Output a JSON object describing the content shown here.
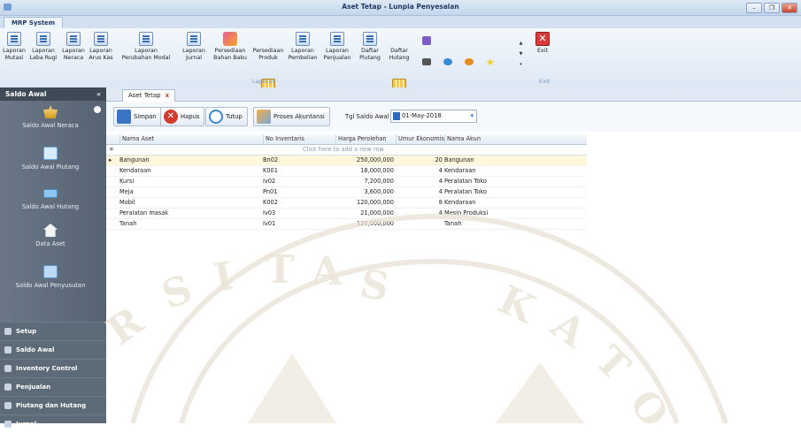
{
  "window": {
    "title": "Aset Tetap - Lunpia Penyesalan"
  },
  "app_tab": "MRP System",
  "ribbon": {
    "buttons": [
      {
        "label": "Laporan\nMutasi",
        "icon": "report-icon"
      },
      {
        "label": "Laporan\nLaba Rugi",
        "icon": "report-icon"
      },
      {
        "label": "Laporan\nNeraca",
        "icon": "report-icon"
      },
      {
        "label": "Laporan\nArus Kas",
        "icon": "report-icon"
      },
      {
        "label": "Laporan\nPerubahan Modal",
        "icon": "report-icon"
      },
      {
        "label": "Laporan\nJurnal",
        "icon": "report-icon"
      },
      {
        "label": "Persediaan\nBahan Baku",
        "icon": "inventory-icon"
      },
      {
        "label": "Persediaan\nProduk",
        "icon": "grid-icon"
      },
      {
        "label": "Laporan\nPembelian",
        "icon": "report-icon"
      },
      {
        "label": "Laporan\nPenjualan",
        "icon": "report-icon"
      },
      {
        "label": "Daftar\nPiutang",
        "icon": "report-icon"
      },
      {
        "label": "Daftar\nHutang",
        "icon": "grid-icon"
      }
    ],
    "group_label": "Laporan",
    "exit_label": "Exit",
    "exit_group": "Exit"
  },
  "sidebar": {
    "header": "Saldo Awal",
    "collapse": "«",
    "items": [
      {
        "label": "Saldo Awal Neraca",
        "icon": "scale-icon"
      },
      {
        "label": "Saldo Awal Piutang",
        "icon": "calculator-icon"
      },
      {
        "label": "Saldo Awal Hutang",
        "icon": "card-icon"
      },
      {
        "label": "Data Aset",
        "icon": "house-icon"
      },
      {
        "label": "Saldo Awal Penyusutan",
        "icon": "download-icon"
      }
    ],
    "nav": [
      "Setup",
      "Saldo Awal",
      "Inventory Control",
      "Penjualan",
      "Piutang dan Hutang",
      "Jurnal"
    ]
  },
  "doc_tab": {
    "label": "Aset Tetap",
    "close": "x"
  },
  "toolbar": {
    "save": "Simpan",
    "delete": "Hapus",
    "close": "Tutup",
    "process": "Proses Akuntansi",
    "date_label": "Tgl Saldo Awal",
    "date_value": "01-May-2018"
  },
  "grid": {
    "columns": [
      "Nama Aset",
      "No Inventaris",
      "Harga Perolehan",
      "Umur Ekonomis",
      "Nama Akun"
    ],
    "new_row_text": "Click here to add a new row",
    "rows": [
      [
        "Bangunan",
        "Bn02",
        "250,000,000",
        "20",
        "Bangunan"
      ],
      [
        "Kendaraan",
        "K001",
        "18,000,000",
        "4",
        "Kendaraan"
      ],
      [
        "Kursi",
        "Iv02",
        "7,200,000",
        "4",
        "Peralatan Toko"
      ],
      [
        "Meja",
        "Pn01",
        "3,600,000",
        "4",
        "Peralatan Toko"
      ],
      [
        "Mobil",
        "K002",
        "120,000,000",
        "8",
        "Kendaraan"
      ],
      [
        "Peralatan masak",
        "Iv03",
        "21,000,000",
        "4",
        "Mesin Produksi"
      ],
      [
        "Tanah",
        "Iv01",
        "120,000,000",
        "",
        "Tanah"
      ]
    ]
  }
}
